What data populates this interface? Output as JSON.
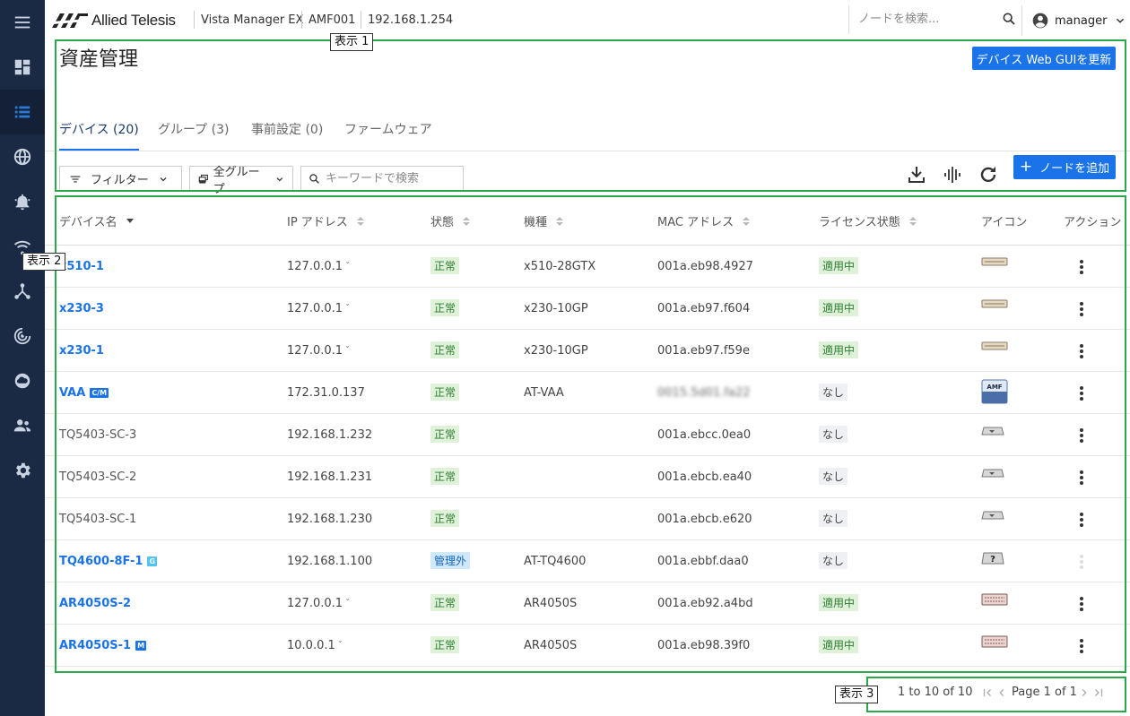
{
  "brand": {
    "logo_text": "Allied Telesis",
    "product": "Vista Manager EX",
    "node": "AMF001",
    "ip": "192.168.1.254"
  },
  "topbar": {
    "search_placeholder": "ノードを検索...",
    "user": "manager"
  },
  "page": {
    "title": "資産管理",
    "update_gui_label": "デバイス Web GUIを更新",
    "add_node_label": "ノードを追加"
  },
  "tabs": [
    {
      "label": "デバイス (20)"
    },
    {
      "label": "グループ (3)"
    },
    {
      "label": "事前設定 (0)"
    },
    {
      "label": "ファームウェア"
    }
  ],
  "toolbar": {
    "filter_label": "フィルター",
    "group_label": "全グループ",
    "keyword_placeholder": "キーワードで検索"
  },
  "table": {
    "headers": [
      "デバイス名",
      "IP アドレス",
      "状態",
      "機種",
      "MAC アドレス",
      "ライセンス状態",
      "アイコン",
      "アクション"
    ],
    "rows": [
      {
        "name": "x510-1",
        "ip": "127.0.0.1",
        "ip_menu": true,
        "status": "正常",
        "model": "x510-28GTX",
        "mac": "001a.eb98.4927",
        "license": "適用中",
        "icon": "switch",
        "link": true
      },
      {
        "name": "x230-3",
        "ip": "127.0.0.1",
        "ip_menu": true,
        "status": "正常",
        "model": "x230-10GP",
        "mac": "001a.eb97.f604",
        "license": "適用中",
        "icon": "switch",
        "link": true
      },
      {
        "name": "x230-1",
        "ip": "127.0.0.1",
        "ip_menu": true,
        "status": "正常",
        "model": "x230-10GP",
        "mac": "001a.eb97.f59e",
        "license": "適用中",
        "icon": "switch",
        "link": true
      },
      {
        "name": "VAA",
        "tag": "C/M",
        "ip": "172.31.0.137",
        "status": "正常",
        "model": "AT-VAA",
        "mac": "0015.5d01.fa22",
        "mac_blurred": true,
        "license": "なし",
        "icon": "amf",
        "link": true
      },
      {
        "name": "TQ5403-SC-3",
        "ip": "192.168.1.232",
        "status": "正常",
        "model": "",
        "mac": "001a.ebcc.0ea0",
        "license": "なし",
        "icon": "ap",
        "link": false
      },
      {
        "name": "TQ5403-SC-2",
        "ip": "192.168.1.231",
        "status": "正常",
        "model": "",
        "mac": "001a.ebcb.ea40",
        "license": "なし",
        "icon": "ap",
        "link": false
      },
      {
        "name": "TQ5403-SC-1",
        "ip": "192.168.1.230",
        "status": "正常",
        "model": "",
        "mac": "001a.ebcb.e620",
        "license": "なし",
        "icon": "ap",
        "link": false
      },
      {
        "name": "TQ4600-8F-1",
        "tag": "G",
        "ip": "192.168.1.100",
        "status": "管理外",
        "model": "AT-TQ4600",
        "mac": "001a.ebbf.daa0",
        "license": "なし",
        "icon": "unknown",
        "link": true,
        "action_disabled": true
      },
      {
        "name": "AR4050S-2",
        "ip": "127.0.0.1",
        "ip_menu": true,
        "status": "正常",
        "model": "AR4050S",
        "mac": "001a.eb92.a4bd",
        "license": "適用中",
        "icon": "router",
        "link": true
      },
      {
        "name": "AR4050S-1",
        "tag": "M",
        "ip": "10.0.0.1",
        "ip_menu": true,
        "status": "正常",
        "model": "AR4050S",
        "mac": "001a.eb98.39f0",
        "license": "適用中",
        "icon": "router",
        "link": true
      }
    ]
  },
  "pager": {
    "range": "1 to 10 of 10",
    "page": "Page 1 of 1"
  },
  "annotations": {
    "a1": "表示 1",
    "a2": "表示 2",
    "a3": "表示 3"
  },
  "colors": {
    "rail": "#1b2a44",
    "accent": "#1a73e8",
    "frame": "#2aa84a"
  }
}
